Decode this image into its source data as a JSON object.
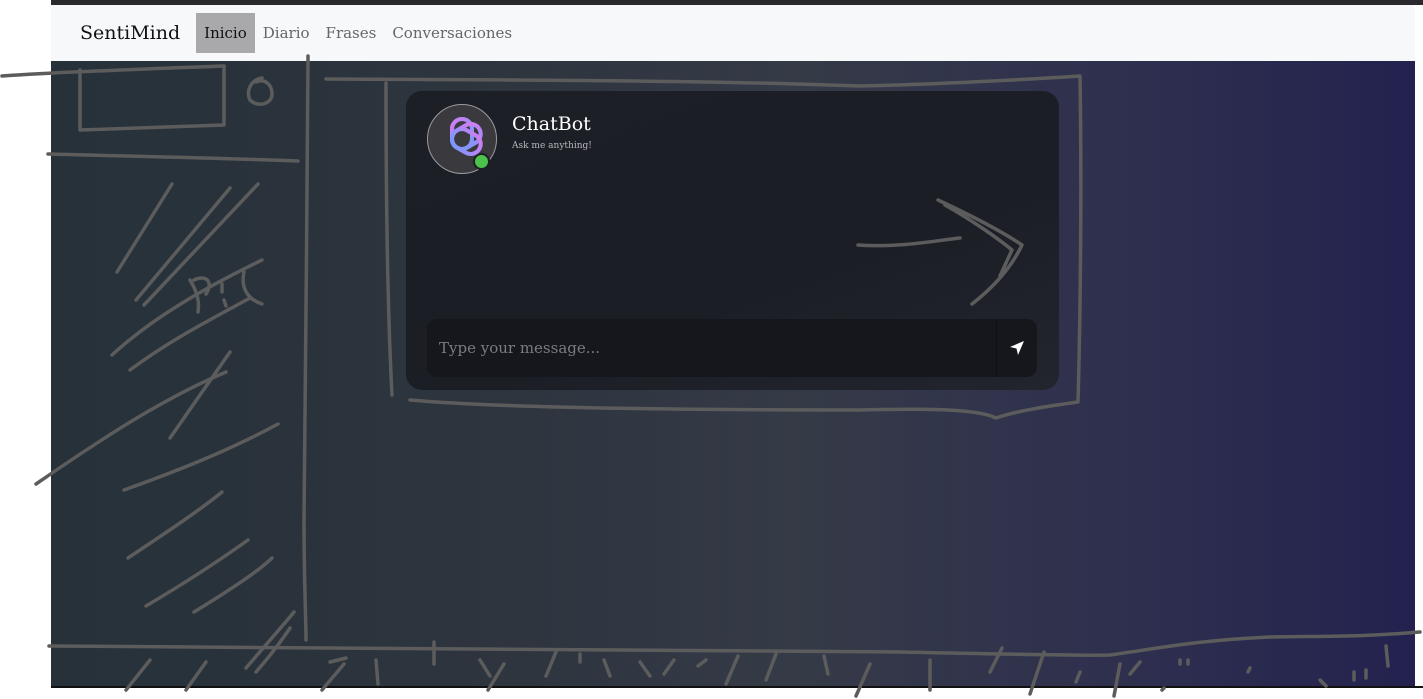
{
  "navbar": {
    "brand": "SentiMind",
    "links": [
      {
        "label": "Inicio",
        "active": true
      },
      {
        "label": "Diario",
        "active": false
      },
      {
        "label": "Frases",
        "active": false
      },
      {
        "label": "Conversaciones",
        "active": false
      }
    ]
  },
  "chat": {
    "bot_name": "ChatBot",
    "bot_subtitle": "Ask me anything!",
    "status": "online",
    "input_placeholder": "Type your message...",
    "send_icon": "send-icon"
  },
  "colors": {
    "online": "#4cc24a",
    "active_nav": "#a9a9ab",
    "gradient_start": "#263139",
    "gradient_end": "#23224f"
  }
}
